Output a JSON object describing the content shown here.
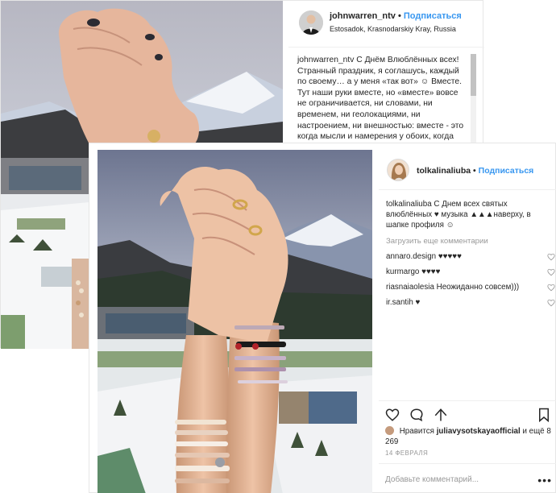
{
  "back_post": {
    "username": "johnwarren_ntv",
    "separator": "•",
    "follow_label": "Подписаться",
    "location": "Estosadok, Krasnodarskiy Kray, Russia",
    "caption_user": "johnwarren_ntv",
    "caption_text": "С Днём Влюблённых всех! Странный праздник, я соглашусь, каждый по своему… а у меня «так вот» ☺ Вместе. Тут наши руки вместе, но «вместе» вовсе не ограничивается, ни словами, ни временем, ни геолокациями, ни настроением, ни внешностью: вместе - это когда мысли и намерения у обоих, когда мечты совпадают, когда не важно"
  },
  "front_post": {
    "username": "tolkalinaliuba",
    "separator": "•",
    "follow_label": "Подписаться",
    "caption_user": "tolkalinaliuba",
    "caption_text": "С Днем всех святых влюблённых ♥ музыка ▲▲▲наверху, в шапке профиля ☺",
    "load_more": "Загрузить еще комментарии",
    "comments": [
      {
        "user": "annaro.design",
        "text": "♥♥♥♥♥"
      },
      {
        "user": "kurmargo",
        "text": "♥♥♥♥"
      },
      {
        "user": "riasnaiaolesia",
        "text": "Неожиданно совсем)))"
      },
      {
        "user": "ir.santih",
        "text": "♥"
      }
    ],
    "likes_prefix": "Нравится",
    "likes_user": "juliavysotskayaofficial",
    "likes_suffix": "и ещё 8 269",
    "date": "14 ФЕВРАЛЯ",
    "add_comment_placeholder": "Добавьте комментарий...",
    "more_label": "•••",
    "icons": [
      "heart-icon",
      "comment-icon",
      "share-icon",
      "bookmark-icon"
    ]
  },
  "colors": {
    "link": "#3897f0",
    "muted": "#999999",
    "text": "#262626",
    "border": "#efefef"
  }
}
